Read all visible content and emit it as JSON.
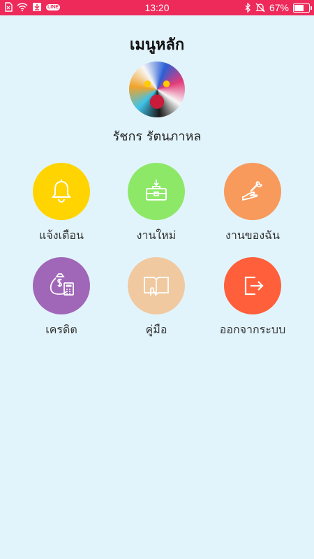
{
  "status_bar": {
    "time": "13:20",
    "battery": "67%",
    "battery_level": 0.67,
    "line_badge": "LINE",
    "left_icons": [
      "sim-icon",
      "wifi-icon",
      "download-icon",
      "line-icon"
    ],
    "right_icons": [
      "bluetooth-icon",
      "mute-icon",
      "battery-icon"
    ]
  },
  "header": {
    "title": "เมนูหลัก"
  },
  "profile": {
    "name": "รัชกร รัตนภาหล"
  },
  "menu": {
    "items": [
      {
        "label": "แจ้งเตือน",
        "icon": "bell-icon",
        "color": "#ffd400"
      },
      {
        "label": "งานใหม่",
        "icon": "toolbox-icon",
        "color": "#8ee868"
      },
      {
        "label": "งานของฉัน",
        "icon": "wrench-hand-icon",
        "color": "#f79a5c"
      },
      {
        "label": "เครดิต",
        "icon": "money-bag-calculator-icon",
        "color": "#a066b8"
      },
      {
        "label": "คู่มือ",
        "icon": "book-hand-icon",
        "color": "#f0c9a0"
      },
      {
        "label": "ออกจากระบบ",
        "icon": "logout-icon",
        "color": "#ff5f3a"
      }
    ]
  }
}
